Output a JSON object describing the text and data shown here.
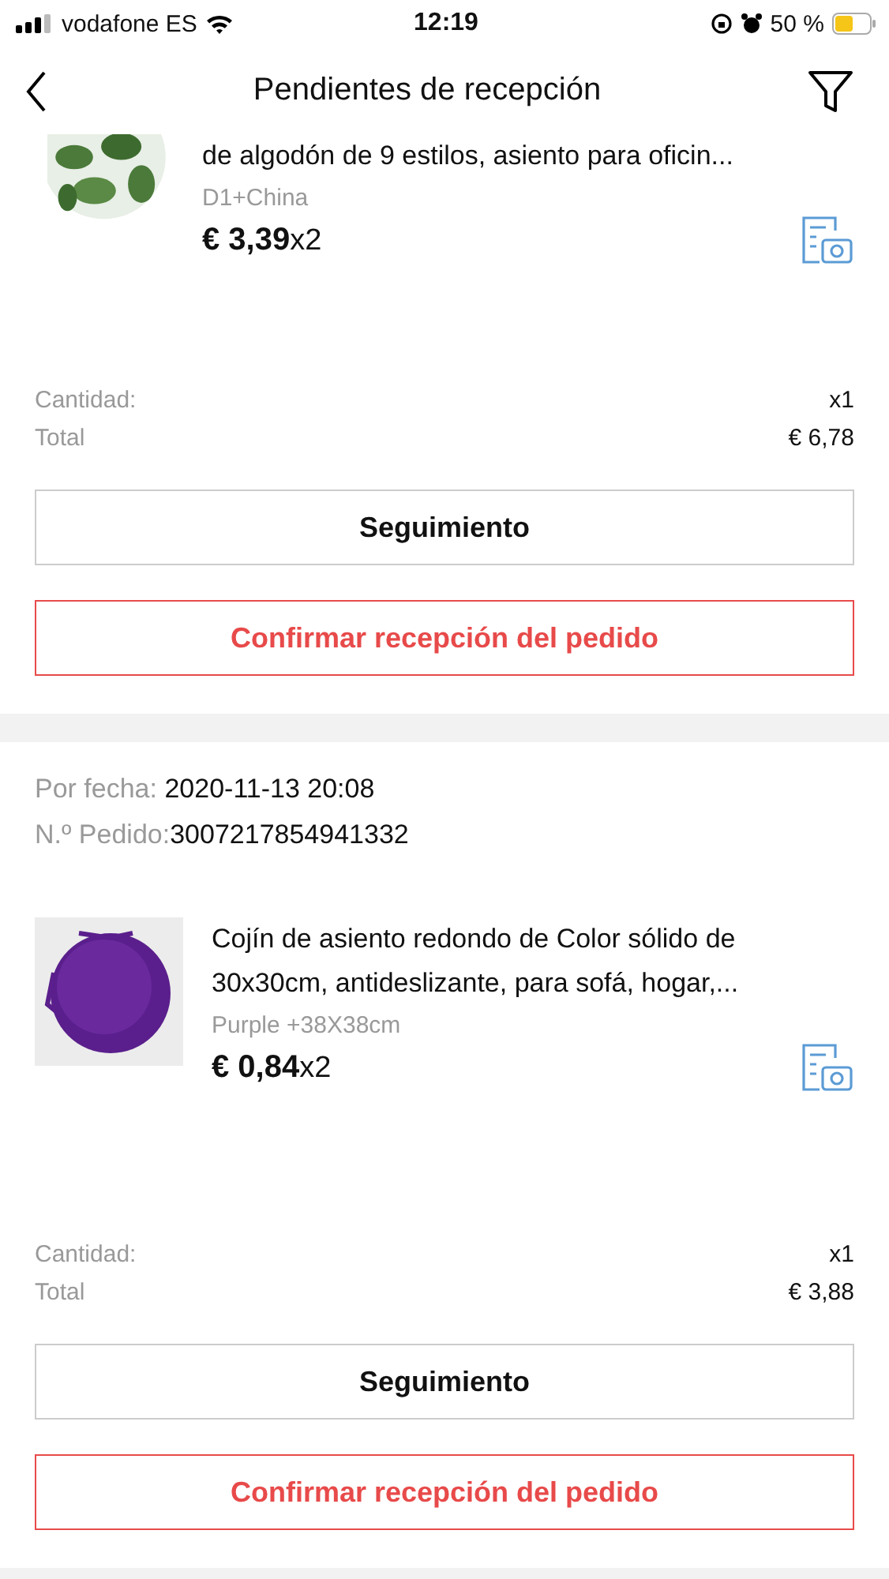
{
  "status_bar": {
    "carrier": "vodafone ES",
    "time": "12:19",
    "battery": "50 %"
  },
  "header": {
    "title": "Pendientes de recepción"
  },
  "orders": [
    {
      "item": {
        "kind": "picture",
        "title": "de algodón de 9 estilos, asiento para oficin...",
        "variant": "D1+China",
        "price": "€ 3,39",
        "qty": "x2"
      },
      "quantity_label": "Cantidad:",
      "quantity": "x1",
      "total_label": "Total",
      "total": "€ 6,78",
      "buttons": [
        {
          "label": "Seguimiento",
          "kind": "outline"
        },
        {
          "label": "Confirmar recepción del pedido",
          "kind": "primary"
        }
      ]
    },
    {
      "date_label": "Por fecha:",
      "date": "2020-11-13 20:08",
      "order_label": "N.º Pedido:",
      "order_no": "3007217854941332",
      "item": {
        "kind": "picture",
        "title": "Cojín de asiento redondo de Color sólido de 30x30cm, antideslizante, para sofá, hogar,...",
        "variant": "Purple +38X38cm",
        "price": "€ 0,84",
        "qty": "x2"
      },
      "quantity_label": "Cantidad:",
      "quantity": "x1",
      "total_label": "Total",
      "total": "€ 3,88",
      "buttons": [
        {
          "label": "Seguimiento",
          "kind": "outline"
        },
        {
          "label": "Confirmar recepción del pedido",
          "kind": "primary"
        }
      ]
    }
  ]
}
